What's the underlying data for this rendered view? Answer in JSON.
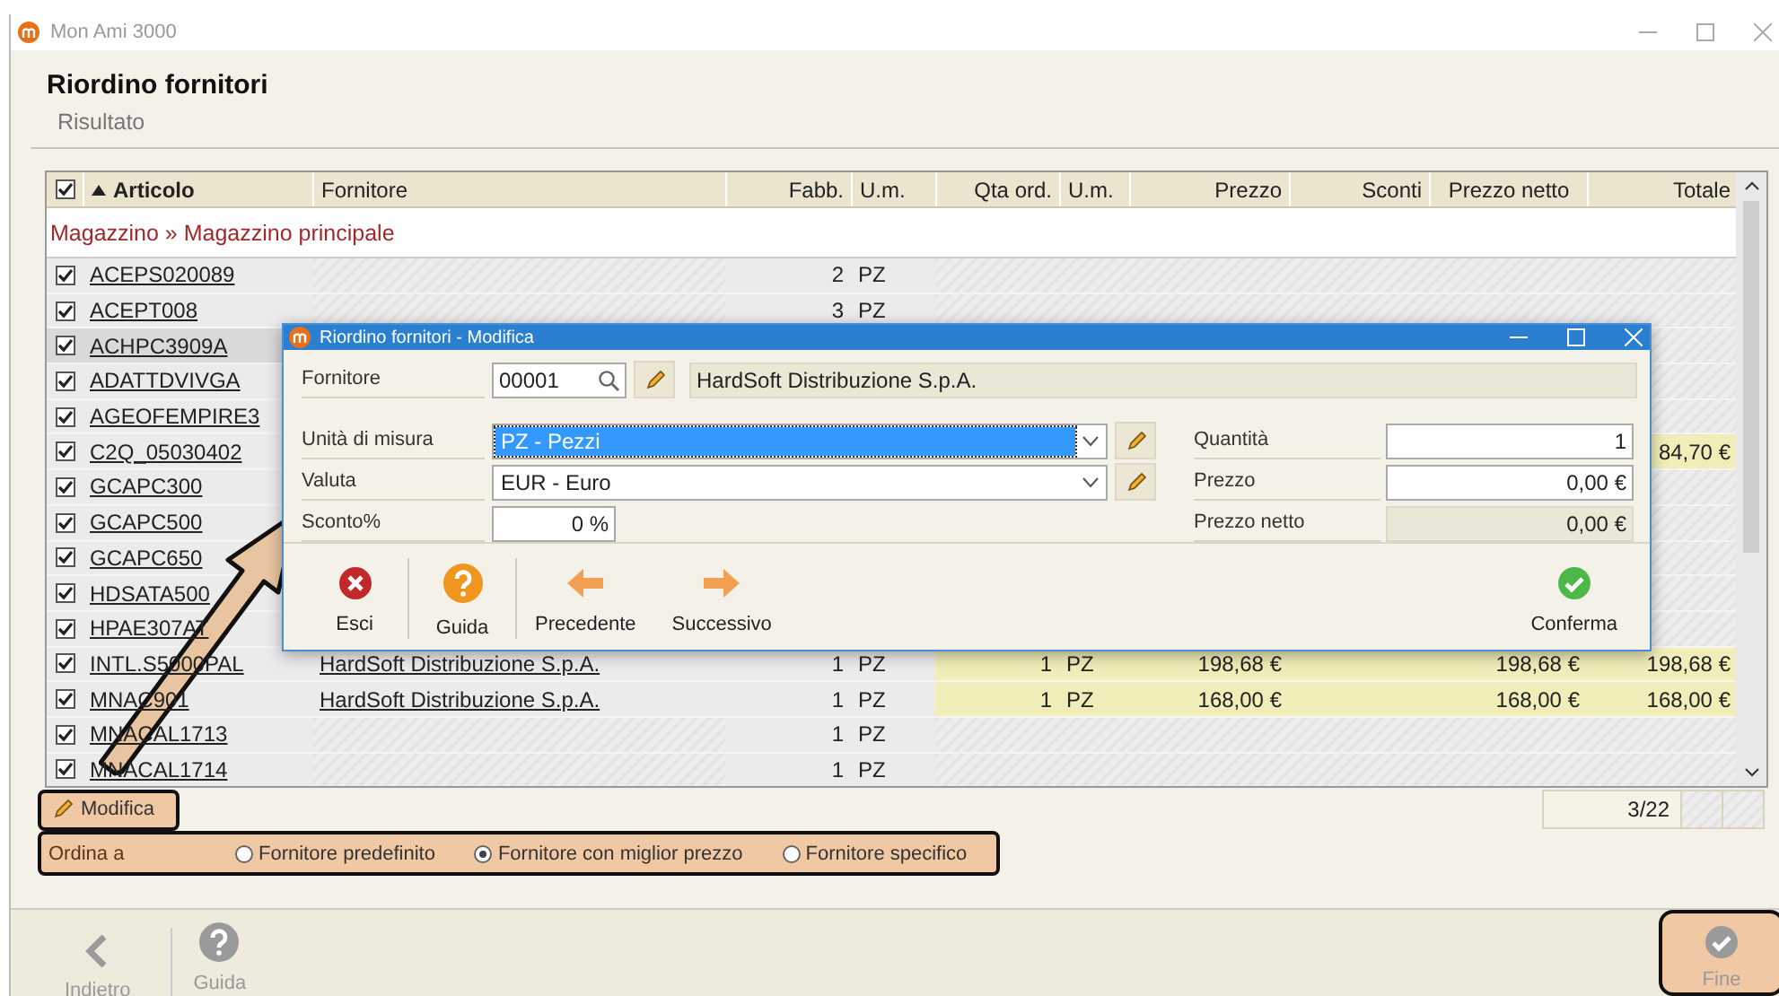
{
  "window": {
    "title": "Mon Ami 3000"
  },
  "page": {
    "title": "Riordino fornitori",
    "subtitle": "Risultato"
  },
  "table": {
    "header_checked": true,
    "columns": [
      {
        "label": "Articolo",
        "sorted": true
      },
      {
        "label": "Fornitore",
        "sorted": false
      },
      {
        "label": "Fabb.",
        "sorted": false
      },
      {
        "label": "U.m.",
        "sorted": false
      },
      {
        "label": "Qta ord.",
        "sorted": false
      },
      {
        "label": "U.m.",
        "sorted": false
      },
      {
        "label": "Prezzo",
        "sorted": false
      },
      {
        "label": "Sconti",
        "sorted": false
      },
      {
        "label": "Prezzo netto",
        "sorted": false
      },
      {
        "label": "Totale",
        "sorted": false
      }
    ],
    "group": "Magazzino » Magazzino principale",
    "rows": [
      {
        "articolo": "ACEPS020089",
        "checked": true,
        "selected": false,
        "priced": false,
        "fabb": "2",
        "um": "PZ"
      },
      {
        "articolo": "ACEPT008",
        "checked": true,
        "selected": false,
        "priced": false,
        "fabb": "3",
        "um": "PZ"
      },
      {
        "articolo": "ACHPC3909A",
        "checked": true,
        "selected": true,
        "priced": false
      },
      {
        "articolo": "ADATTDVIVGA",
        "checked": true,
        "selected": false,
        "priced": false
      },
      {
        "articolo": "AGEOFEMPIRE3",
        "checked": true,
        "selected": false,
        "priced": false
      },
      {
        "articolo": "C2Q_05030402",
        "checked": true,
        "selected": false,
        "priced": true,
        "totale": "84,70 €"
      },
      {
        "articolo": "GCAPC300",
        "checked": true,
        "selected": false,
        "priced": false
      },
      {
        "articolo": "GCAPC500",
        "checked": true,
        "selected": false,
        "priced": false
      },
      {
        "articolo": "GCAPC650",
        "checked": true,
        "selected": false,
        "priced": false
      },
      {
        "articolo": "HDSATA500",
        "checked": true,
        "selected": false,
        "priced": false
      },
      {
        "articolo": "HPAE307AT",
        "checked": true,
        "selected": false,
        "priced": false
      },
      {
        "articolo": "INTL.S5000PAL",
        "checked": true,
        "selected": false,
        "priced": true,
        "fornitore": "HardSoft Distribuzione S.p.A.",
        "fabb": "1",
        "um": "PZ",
        "qta": "1",
        "um_ord": "PZ",
        "prezzo": "198,68 €",
        "netto": "198,68 €",
        "totale": "198,68 €"
      },
      {
        "articolo": "MNAC901",
        "checked": true,
        "selected": false,
        "priced": true,
        "fornitore": "HardSoft Distribuzione S.p.A.",
        "fabb": "1",
        "um": "PZ",
        "qta": "1",
        "um_ord": "PZ",
        "prezzo": "168,00 €",
        "netto": "168,00 €",
        "totale": "168,00 €"
      },
      {
        "articolo": "MNACAL1713",
        "checked": true,
        "selected": false,
        "priced": false,
        "fabb": "1",
        "um": "PZ"
      },
      {
        "articolo": "MNACAL1714",
        "checked": true,
        "selected": false,
        "priced": false,
        "fabb": "1",
        "um": "PZ"
      }
    ]
  },
  "edit_button": {
    "label": "Modifica",
    "highlighted": true
  },
  "counter": "3/22",
  "order_by": {
    "label": "Ordina a",
    "highlighted": true,
    "options": [
      {
        "label": "Fornitore predefinito",
        "selected": false
      },
      {
        "label": "Fornitore con miglior prezzo",
        "selected": true
      },
      {
        "label": "Fornitore specifico",
        "selected": false
      }
    ]
  },
  "footer": [
    {
      "label": "Indietro",
      "disabled": true,
      "highlighted": false,
      "separator_after": true
    },
    {
      "label": "Guida",
      "disabled": true,
      "highlighted": false,
      "separator_after": false
    },
    {
      "label": "Fine",
      "disabled": true,
      "highlighted": true,
      "separator_after": false
    }
  ],
  "annotations": [
    {
      "kind": "arrow"
    }
  ],
  "dialog": {
    "title": "Riordino fornitori - Modifica",
    "supplier": {
      "label": "Fornitore",
      "code": "00001",
      "name": "HardSoft Distribuzione S.p.A."
    },
    "left_fields": [
      {
        "label": "Unità di misura",
        "kind": "select",
        "value": "PZ - Pezzi",
        "focused": true
      },
      {
        "label": "Valuta",
        "kind": "select",
        "value": "EUR - Euro",
        "focused": false
      },
      {
        "label": "Sconto%",
        "kind": "input",
        "value": "0 %"
      }
    ],
    "right_fields": [
      {
        "label": "Quantità",
        "value": "1",
        "readonly": false
      },
      {
        "label": "Prezzo",
        "value": "0,00 €",
        "readonly": false
      },
      {
        "label": "Prezzo netto",
        "value": "0,00 €",
        "readonly": true
      }
    ],
    "toolbar": [
      {
        "label": "Esci",
        "separator_after": true
      },
      {
        "label": "Guida",
        "separator_after": true
      },
      {
        "label": "Precedente",
        "separator_after": false
      },
      {
        "label": "Successivo",
        "separator_after": false
      },
      {
        "label": "Conferma",
        "separator_after": false
      }
    ]
  }
}
